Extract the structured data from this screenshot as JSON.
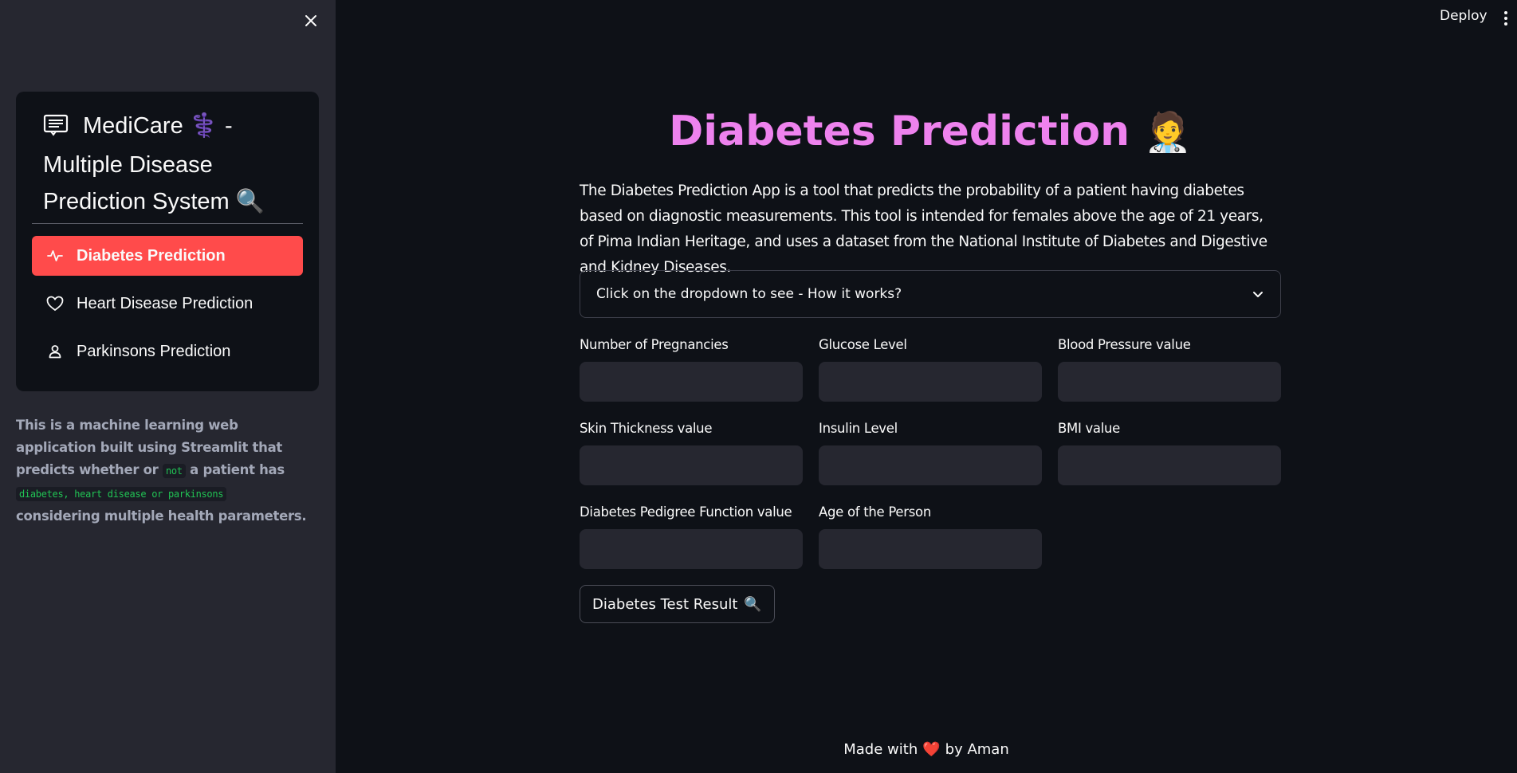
{
  "header": {
    "deploy_label": "Deploy",
    "menu_icon": "kebab-menu-icon"
  },
  "sidebar": {
    "close_icon": "close-icon",
    "menu_title_icon": "receipt-icon",
    "menu_title_prefix": "MediCare",
    "menu_title_emoji1": "⚕️",
    "menu_title_suffix": " - Multiple Disease Prediction System",
    "menu_title_emoji2": "🔍",
    "items": [
      {
        "label": "Diabetes Prediction",
        "icon": "activity-icon",
        "active": true
      },
      {
        "label": "Heart Disease Prediction",
        "icon": "heart-icon",
        "active": false
      },
      {
        "label": "Parkinsons Prediction",
        "icon": "person-icon",
        "active": false
      }
    ],
    "description": {
      "part1": "This is a machine learning web application built using Streamlit that predicts whether or ",
      "code1": "not",
      "part2": " a patient has ",
      "code2": "diabetes, heart disease or parkinsons",
      "part3": " considering multiple health parameters."
    },
    "accent_color": "#ff4b4b"
  },
  "main": {
    "title": "Diabetes Prediction",
    "title_emoji": "🧑‍⚕️",
    "title_color": "#ee82ee",
    "intro": "The Diabetes Prediction App is a tool that predicts the probability of a patient having diabetes based on diagnostic measurements. This tool is intended for females above the age of 21 years, of Pima Indian Heritage, and uses a dataset from the National Institute of Diabetes and Digestive and Kidney Diseases.",
    "expander_label": "Click on the dropdown to see - How it works?",
    "fields": [
      {
        "label": "Number of Pregnancies",
        "value": ""
      },
      {
        "label": "Glucose Level",
        "value": ""
      },
      {
        "label": "Blood Pressure value",
        "value": ""
      },
      {
        "label": "Skin Thickness value",
        "value": ""
      },
      {
        "label": "Insulin Level",
        "value": ""
      },
      {
        "label": "BMI value",
        "value": ""
      },
      {
        "label": "Diabetes Pedigree Function value",
        "value": ""
      },
      {
        "label": "Age of the Person",
        "value": ""
      }
    ],
    "result_button_label": "Diabetes Test Result",
    "result_button_emoji": "🔍"
  },
  "footer": {
    "prefix": "Made with",
    "heart": "❤️",
    "suffix": "by Aman"
  }
}
